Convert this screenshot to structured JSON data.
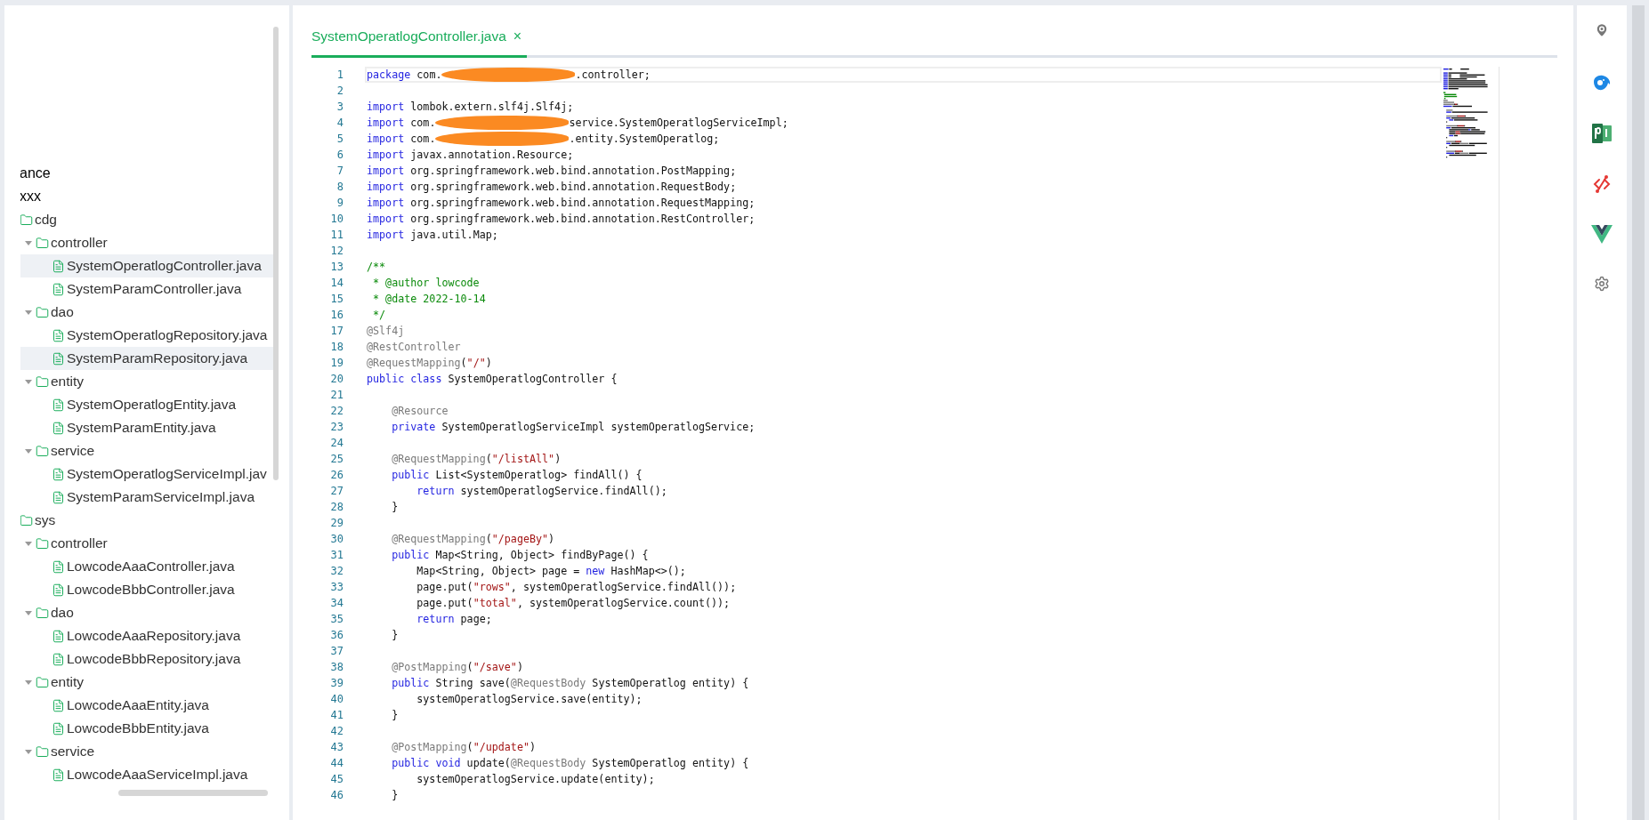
{
  "tree": {
    "items": [
      {
        "label": "ance",
        "kind": "label",
        "selected": false
      },
      {
        "label": "xxx",
        "kind": "label",
        "selected": false
      },
      {
        "label": "cdg",
        "kind": "folder",
        "selected": false,
        "children": [
          {
            "label": "controller",
            "kind": "folder",
            "expanded": true,
            "selected": false,
            "children": [
              {
                "label": "SystemOperatlogController.java",
                "kind": "file",
                "selected": true
              },
              {
                "label": "SystemParamController.java",
                "kind": "file",
                "selected": false
              }
            ]
          },
          {
            "label": "dao",
            "kind": "folder",
            "expanded": true,
            "selected": false,
            "children": [
              {
                "label": "SystemOperatlogRepository.java",
                "kind": "file",
                "selected": false
              },
              {
                "label": "SystemParamRepository.java",
                "kind": "file",
                "selected": true
              }
            ]
          },
          {
            "label": "entity",
            "kind": "folder",
            "expanded": true,
            "selected": false,
            "children": [
              {
                "label": "SystemOperatlogEntity.java",
                "kind": "file",
                "selected": false
              },
              {
                "label": "SystemParamEntity.java",
                "kind": "file",
                "selected": false
              }
            ]
          },
          {
            "label": "service",
            "kind": "folder",
            "expanded": true,
            "selected": false,
            "children": [
              {
                "label": "SystemOperatlogServiceImpl.jav",
                "kind": "file",
                "selected": false
              },
              {
                "label": "SystemParamServiceImpl.java",
                "kind": "file",
                "selected": false
              }
            ]
          }
        ]
      },
      {
        "label": "sys",
        "kind": "folder",
        "selected": false,
        "children": [
          {
            "label": "controller",
            "kind": "folder",
            "expanded": true,
            "selected": false,
            "children": [
              {
                "label": "LowcodeAaaController.java",
                "kind": "file",
                "selected": false
              },
              {
                "label": "LowcodeBbbController.java",
                "kind": "file",
                "selected": false
              }
            ]
          },
          {
            "label": "dao",
            "kind": "folder",
            "expanded": true,
            "selected": false,
            "children": [
              {
                "label": "LowcodeAaaRepository.java",
                "kind": "file",
                "selected": false
              },
              {
                "label": "LowcodeBbbRepository.java",
                "kind": "file",
                "selected": false
              }
            ]
          },
          {
            "label": "entity",
            "kind": "folder",
            "expanded": true,
            "selected": false,
            "children": [
              {
                "label": "LowcodeAaaEntity.java",
                "kind": "file",
                "selected": false
              },
              {
                "label": "LowcodeBbbEntity.java",
                "kind": "file",
                "selected": false
              }
            ]
          },
          {
            "label": "service",
            "kind": "folder",
            "expanded": true,
            "selected": false,
            "children": [
              {
                "label": "LowcodeAaaServiceImpl.java",
                "kind": "file",
                "selected": false
              }
            ]
          }
        ]
      }
    ]
  },
  "editor": {
    "tabs": [
      {
        "label": "SystemOperatlogController.java",
        "close": "×",
        "selected": true
      }
    ],
    "lines": [
      {
        "number": "1",
        "current": true,
        "tokens": [
          {
            "kind": "kw",
            "text": "package"
          },
          {
            "kind": "plain",
            "text": " com."
          },
          {
            "kind": "redacted"
          },
          {
            "kind": "plain",
            "text": ".controller;"
          }
        ]
      },
      {
        "number": "2",
        "current": false
      },
      {
        "number": "3",
        "current": false,
        "tokens": [
          {
            "kind": "kw",
            "text": "import"
          },
          {
            "kind": "plain",
            "text": " lombok.extern.slf4j.Slf4j;"
          }
        ]
      },
      {
        "number": "4",
        "current": false,
        "tokens": [
          {
            "kind": "kw",
            "text": "import"
          },
          {
            "kind": "plain",
            "text": " com."
          },
          {
            "kind": "redacted"
          },
          {
            "kind": "plain",
            "text": "service.SystemOperatlogServiceImpl;"
          }
        ]
      },
      {
        "number": "5",
        "current": false,
        "tokens": [
          {
            "kind": "kw",
            "text": "import"
          },
          {
            "kind": "plain",
            "text": " com."
          },
          {
            "kind": "redacted"
          },
          {
            "kind": "plain",
            "text": ".entity.SystemOperatlog;"
          }
        ]
      },
      {
        "number": "6",
        "current": false,
        "tokens": [
          {
            "kind": "kw",
            "text": "import"
          },
          {
            "kind": "plain",
            "text": " javax.annotation.Resource;"
          }
        ]
      },
      {
        "number": "7",
        "current": false,
        "tokens": [
          {
            "kind": "kw",
            "text": "import"
          },
          {
            "kind": "plain",
            "text": " org.springframework.web.bind.annotation.PostMapping;"
          }
        ]
      },
      {
        "number": "8",
        "current": false,
        "tokens": [
          {
            "kind": "kw",
            "text": "import"
          },
          {
            "kind": "plain",
            "text": " org.springframework.web.bind.annotation.RequestBody;"
          }
        ]
      },
      {
        "number": "9",
        "current": false,
        "tokens": [
          {
            "kind": "kw",
            "text": "import"
          },
          {
            "kind": "plain",
            "text": " org.springframework.web.bind.annotation.RequestMapping;"
          }
        ]
      },
      {
        "number": "10",
        "current": false,
        "tokens": [
          {
            "kind": "kw",
            "text": "import"
          },
          {
            "kind": "plain",
            "text": " org.springframework.web.bind.annotation.RestController;"
          }
        ]
      },
      {
        "number": "11",
        "current": false,
        "tokens": [
          {
            "kind": "kw",
            "text": "import"
          },
          {
            "kind": "plain",
            "text": " java.util.Map;"
          }
        ]
      },
      {
        "number": "12",
        "current": false
      },
      {
        "number": "13",
        "current": false,
        "tokens": [
          {
            "kind": "comment",
            "text": "/**"
          }
        ]
      },
      {
        "number": "14",
        "current": false,
        "tokens": [
          {
            "kind": "comment",
            "text": " * @author lowcode"
          }
        ]
      },
      {
        "number": "15",
        "current": false,
        "tokens": [
          {
            "kind": "comment",
            "text": " * @date 2022-10-14"
          }
        ]
      },
      {
        "number": "16",
        "current": false,
        "tokens": [
          {
            "kind": "comment",
            "text": " */"
          }
        ]
      },
      {
        "number": "17",
        "current": false,
        "tokens": [
          {
            "kind": "ann",
            "text": "@Slf4j"
          }
        ]
      },
      {
        "number": "18",
        "current": false,
        "tokens": [
          {
            "kind": "ann",
            "text": "@RestController"
          }
        ]
      },
      {
        "number": "19",
        "current": false,
        "tokens": [
          {
            "kind": "ann",
            "text": "@RequestMapping"
          },
          {
            "kind": "plain",
            "text": "("
          },
          {
            "kind": "str",
            "text": "\"/\""
          },
          {
            "kind": "plain",
            "text": ")"
          }
        ]
      },
      {
        "number": "20",
        "current": false,
        "tokens": [
          {
            "kind": "kw",
            "text": "public class"
          },
          {
            "kind": "plain",
            "text": " SystemOperatlogController {"
          }
        ]
      },
      {
        "number": "21",
        "current": false
      },
      {
        "number": "22",
        "current": false,
        "tokens": [
          {
            "kind": "ann",
            "text": "    @Resource"
          }
        ]
      },
      {
        "number": "23",
        "current": false,
        "tokens": [
          {
            "kind": "kw",
            "text": "    private"
          },
          {
            "kind": "plain",
            "text": " SystemOperatlogServiceImpl systemOperatlogService;"
          }
        ]
      },
      {
        "number": "24",
        "current": false
      },
      {
        "number": "25",
        "current": false,
        "tokens": [
          {
            "kind": "ann",
            "text": "    @RequestMapping"
          },
          {
            "kind": "plain",
            "text": "("
          },
          {
            "kind": "str",
            "text": "\"/listAll\""
          },
          {
            "kind": "plain",
            "text": ")"
          }
        ]
      },
      {
        "number": "26",
        "current": false,
        "tokens": [
          {
            "kind": "kw",
            "text": "    public"
          },
          {
            "kind": "plain",
            "text": " List<SystemOperatlog> findAll() {"
          }
        ]
      },
      {
        "number": "27",
        "current": false,
        "tokens": [
          {
            "kind": "kw",
            "text": "        return"
          },
          {
            "kind": "plain",
            "text": " systemOperatlogService.findAll();"
          }
        ]
      },
      {
        "number": "28",
        "current": false,
        "tokens": [
          {
            "kind": "plain",
            "text": "    }"
          }
        ]
      },
      {
        "number": "29",
        "current": false
      },
      {
        "number": "30",
        "current": false,
        "tokens": [
          {
            "kind": "ann",
            "text": "    @RequestMapping"
          },
          {
            "kind": "plain",
            "text": "("
          },
          {
            "kind": "str",
            "text": "\"/pageBy\""
          },
          {
            "kind": "plain",
            "text": ")"
          }
        ]
      },
      {
        "number": "31",
        "current": false,
        "tokens": [
          {
            "kind": "kw",
            "text": "    public"
          },
          {
            "kind": "plain",
            "text": " Map<String, Object> findByPage() {"
          }
        ]
      },
      {
        "number": "32",
        "current": false,
        "tokens": [
          {
            "kind": "plain",
            "text": "        Map<String, Object> page = "
          },
          {
            "kind": "kw",
            "text": "new"
          },
          {
            "kind": "plain",
            "text": " HashMap<>();"
          }
        ]
      },
      {
        "number": "33",
        "current": false,
        "tokens": [
          {
            "kind": "plain",
            "text": "        page.put("
          },
          {
            "kind": "str",
            "text": "\"rows\""
          },
          {
            "kind": "plain",
            "text": ", systemOperatlogService.findAll());"
          }
        ]
      },
      {
        "number": "34",
        "current": false,
        "tokens": [
          {
            "kind": "plain",
            "text": "        page.put("
          },
          {
            "kind": "str",
            "text": "\"total\""
          },
          {
            "kind": "plain",
            "text": ", systemOperatlogService.count());"
          }
        ]
      },
      {
        "number": "35",
        "current": false,
        "tokens": [
          {
            "kind": "kw",
            "text": "        return"
          },
          {
            "kind": "plain",
            "text": " page;"
          }
        ]
      },
      {
        "number": "36",
        "current": false,
        "tokens": [
          {
            "kind": "plain",
            "text": "    }"
          }
        ]
      },
      {
        "number": "37",
        "current": false
      },
      {
        "number": "38",
        "current": false,
        "tokens": [
          {
            "kind": "ann",
            "text": "    @PostMapping"
          },
          {
            "kind": "plain",
            "text": "("
          },
          {
            "kind": "str",
            "text": "\"/save\""
          },
          {
            "kind": "plain",
            "text": ")"
          }
        ]
      },
      {
        "number": "39",
        "current": false,
        "tokens": [
          {
            "kind": "kw",
            "text": "    public"
          },
          {
            "kind": "plain",
            "text": " String save("
          },
          {
            "kind": "ann",
            "text": "@RequestBody"
          },
          {
            "kind": "plain",
            "text": " SystemOperatlog entity) {"
          }
        ]
      },
      {
        "number": "40",
        "current": false,
        "tokens": [
          {
            "kind": "plain",
            "text": "        systemOperatlogService.save(entity);"
          }
        ]
      },
      {
        "number": "41",
        "current": false,
        "tokens": [
          {
            "kind": "plain",
            "text": "    }"
          }
        ]
      },
      {
        "number": "42",
        "current": false
      },
      {
        "number": "43",
        "current": false,
        "tokens": [
          {
            "kind": "ann",
            "text": "    @PostMapping"
          },
          {
            "kind": "plain",
            "text": "("
          },
          {
            "kind": "str",
            "text": "\"/update\""
          },
          {
            "kind": "plain",
            "text": ")"
          }
        ]
      },
      {
        "number": "44",
        "current": false,
        "tokens": [
          {
            "kind": "kw",
            "text": "    public void"
          },
          {
            "kind": "plain",
            "text": " update("
          },
          {
            "kind": "ann",
            "text": "@RequestBody"
          },
          {
            "kind": "plain",
            "text": " SystemOperatlog entity) {"
          }
        ]
      },
      {
        "number": "45",
        "current": false,
        "tokens": [
          {
            "kind": "plain",
            "text": "        systemOperatlogService.update(entity);"
          }
        ]
      },
      {
        "number": "46",
        "current": false,
        "tokens": [
          {
            "kind": "plain",
            "text": "    }"
          }
        ]
      }
    ]
  }
}
